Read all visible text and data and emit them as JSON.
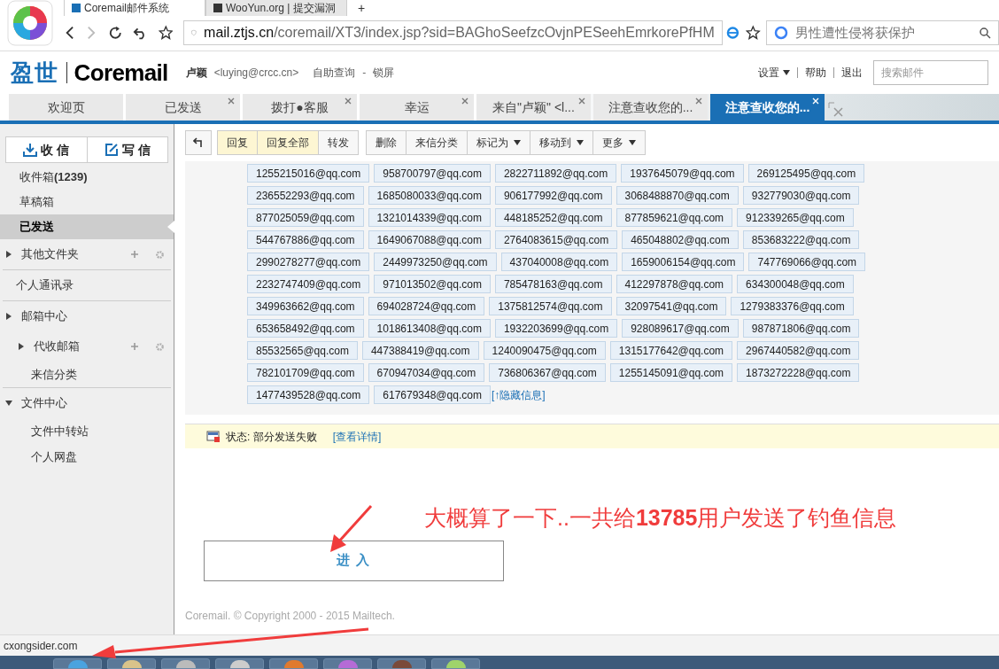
{
  "browser": {
    "tabs": [
      {
        "title": "Coremail邮件系统",
        "selected": true
      },
      {
        "title": "WooYun.org | 提交漏洞",
        "selected": false
      }
    ],
    "new_tab": "+",
    "url_host": "mail.ztjs.cn",
    "url_path": "/coremail/XT3/index.jsp?sid=BAGhoSeefzcOvjnPESeehEmrkorePfHM",
    "search": {
      "placeholder": "男性遭性侵将获保护"
    }
  },
  "header": {
    "logo_cn": "盈世",
    "logo_en": "Coremail",
    "user_name": "卢颖",
    "user_email": "<luying@crcc.cn>",
    "links": [
      "自助查询",
      "锁屏"
    ],
    "link_sep": "-",
    "menu": [
      {
        "label": "设置",
        "dropdown": true
      },
      {
        "label": "帮助",
        "dropdown": false
      },
      {
        "label": "退出",
        "dropdown": false
      }
    ],
    "search": {
      "placeholder": "搜索邮件"
    }
  },
  "tabs": [
    {
      "label": "欢迎页",
      "closable": false,
      "selected": false
    },
    {
      "label": "已发送",
      "closable": true,
      "selected": false
    },
    {
      "label": "拨打●客服",
      "closable": true,
      "selected": false
    },
    {
      "label": "幸运",
      "closable": true,
      "selected": false
    },
    {
      "label": "来自\"卢颖\" <l...",
      "closable": true,
      "selected": false
    },
    {
      "label": "注意查收您的...",
      "closable": true,
      "selected": false
    },
    {
      "label": "注意查收您的...",
      "closable": true,
      "selected": true
    }
  ],
  "actions": [
    {
      "label": "收 信",
      "kind": "receive"
    },
    {
      "label": "写 信",
      "kind": "compose"
    }
  ],
  "sidebar": [
    {
      "label": "收件箱",
      "count": "(1239)",
      "kind": "folder",
      "selected": false
    },
    {
      "label": "草稿箱",
      "kind": "folder",
      "selected": false
    },
    {
      "label": "已发送",
      "kind": "folder",
      "selected": true
    },
    {
      "label": "其他文件夹",
      "kind": "tree",
      "expanded": false,
      "tools": true
    },
    {
      "label": "个人通讯录",
      "kind": "link"
    },
    {
      "label": "邮箱中心",
      "kind": "tree",
      "expanded": false,
      "children": [
        {
          "label": "代收邮箱",
          "kind": "tree",
          "expanded": false,
          "tools": true
        },
        {
          "label": "来信分类",
          "kind": "leaf"
        }
      ]
    },
    {
      "label": "文件中心",
      "kind": "tree",
      "expanded": true,
      "children": [
        {
          "label": "文件中转站",
          "kind": "leaf"
        },
        {
          "label": "个人网盘",
          "kind": "leaf"
        }
      ]
    }
  ],
  "toolbar": [
    [
      {
        "label": "回复",
        "highlighted": true,
        "dropdown": false
      },
      {
        "label": "回复全部",
        "highlighted": true,
        "dropdown": false
      },
      {
        "label": "转发",
        "highlighted": false,
        "dropdown": false
      }
    ],
    [
      {
        "label": "删除",
        "highlighted": false,
        "dropdown": false
      },
      {
        "label": "来信分类",
        "highlighted": false,
        "dropdown": false
      },
      {
        "label": "标记为",
        "highlighted": false,
        "dropdown": true
      },
      {
        "label": "移动到",
        "highlighted": false,
        "dropdown": true
      },
      {
        "label": "更多",
        "highlighted": false,
        "dropdown": true
      }
    ]
  ],
  "recipient_rows": [
    [
      "1255215016@qq.com",
      "958700797@qq.com",
      "2822711892@qq.com",
      "1937645079@qq.com",
      "269125495@qq.com"
    ],
    [
      "236552293@qq.com",
      "1685080033@qq.com",
      "906177992@qq.com",
      "3068488870@qq.com",
      "932779030@qq.com"
    ],
    [
      "877025059@qq.com",
      "1321014339@qq.com",
      "448185252@qq.com",
      "877859621@qq.com",
      "912339265@qq.com"
    ],
    [
      "544767886@qq.com",
      "1649067088@qq.com",
      "2764083615@qq.com",
      "465048802@qq.com",
      "853683222@qq.com"
    ],
    [
      "2990278277@qq.com",
      "2449973250@qq.com",
      "437040008@qq.com",
      "1659006154@qq.com",
      "747769066@qq.com"
    ],
    [
      "2232747409@qq.com",
      "971013502@qq.com",
      "785478163@qq.com",
      "412297878@qq.com",
      "634300048@qq.com"
    ],
    [
      "349963662@qq.com",
      "694028724@qq.com",
      "1375812574@qq.com",
      "32097541@qq.com",
      "1279383376@qq.com"
    ],
    [
      "653658492@qq.com",
      "1018613408@qq.com",
      "1932203699@qq.com",
      "928089617@qq.com",
      "987871806@qq.com"
    ],
    [
      "85532565@qq.com",
      "447388419@qq.com",
      "1240090475@qq.com",
      "1315177642@qq.com",
      "2967440582@qq.com"
    ],
    [
      "782101709@qq.com",
      "670947034@qq.com",
      "736806367@qq.com",
      "1255145091@qq.com",
      "1873272228@qq.com"
    ],
    [
      "1477439528@qq.com",
      "617679348@qq.com"
    ]
  ],
  "hide_link": "[↑隐藏信息]",
  "status": {
    "text": "状态: 部分发送失败",
    "link": "[查看详情]"
  },
  "annotation": "大概算了一下..一共给**13785**用户发送了钓鱼信息",
  "enter_button": "进 入",
  "copyright": "Coremail. © Copyright 2000 - 2015 Mailtech.",
  "status_bar": "cxongsider.com"
}
